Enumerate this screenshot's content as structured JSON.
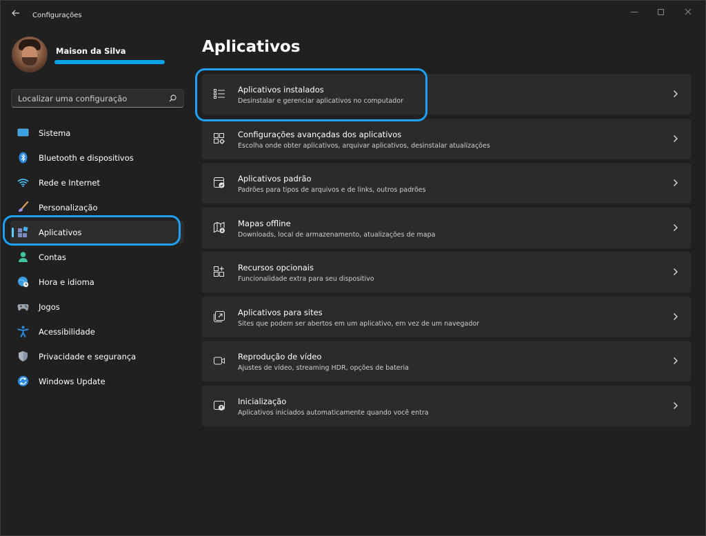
{
  "window": {
    "title": "Configurações"
  },
  "profile": {
    "name": "Maison da Silva"
  },
  "search": {
    "placeholder": "Localizar uma configuração"
  },
  "nav": {
    "items": [
      {
        "label": "Sistema",
        "icon": "monitor-icon"
      },
      {
        "label": "Bluetooth e dispositivos",
        "icon": "bluetooth-icon"
      },
      {
        "label": "Rede e Internet",
        "icon": "wifi-icon"
      },
      {
        "label": "Personalização",
        "icon": "brush-icon"
      },
      {
        "label": "Aplicativos",
        "icon": "apps-icon",
        "selected": true
      },
      {
        "label": "Contas",
        "icon": "person-icon"
      },
      {
        "label": "Hora e idioma",
        "icon": "globe-clock-icon"
      },
      {
        "label": "Jogos",
        "icon": "gamepad-icon"
      },
      {
        "label": "Acessibilidade",
        "icon": "accessibility-icon"
      },
      {
        "label": "Privacidade e segurança",
        "icon": "shield-icon"
      },
      {
        "label": "Windows Update",
        "icon": "update-icon"
      }
    ]
  },
  "main": {
    "title": "Aplicativos",
    "cards": [
      {
        "title": "Aplicativos instalados",
        "subtitle": "Desinstalar e gerenciar aplicativos no computador",
        "icon": "list-icon"
      },
      {
        "title": "Configurações avançadas dos aplicativos",
        "subtitle": "Escolha onde obter aplicativos, arquivar aplicativos, desinstalar atualizações",
        "icon": "advanced-apps-icon"
      },
      {
        "title": "Aplicativos padrão",
        "subtitle": "Padrões para tipos de arquivos e de links, outros padrões",
        "icon": "default-apps-icon"
      },
      {
        "title": "Mapas offline",
        "subtitle": "Downloads, local de armazenamento, atualizações de mapa",
        "icon": "map-icon"
      },
      {
        "title": "Recursos opcionais",
        "subtitle": "Funcionalidade extra para seu dispositivo",
        "icon": "optional-features-icon"
      },
      {
        "title": "Aplicativos para sites",
        "subtitle": "Sites que podem ser abertos em um aplicativo, em vez de um navegador",
        "icon": "open-in-app-icon"
      },
      {
        "title": "Reprodução de vídeo",
        "subtitle": "Ajustes de vídeo, streaming HDR, opções de bateria",
        "icon": "video-icon"
      },
      {
        "title": "Inicialização",
        "subtitle": "Aplicativos iniciados automaticamente quando você entra",
        "icon": "startup-icon"
      }
    ]
  },
  "colors": {
    "accent": "#60cdff",
    "annotation": "#1da1f2",
    "card_bg": "#2b2b2b",
    "window_bg": "#202020"
  }
}
